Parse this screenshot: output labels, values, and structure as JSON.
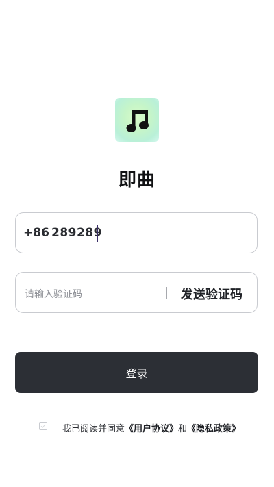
{
  "app": {
    "name": "即曲",
    "logo_icon": "music-note-icon",
    "logo_colors": [
      "#d9fbc9",
      "#b9f0d8"
    ]
  },
  "phone": {
    "country_code": "+86",
    "value": "289289"
  },
  "verification": {
    "placeholder": "请输入验证码",
    "send_label": "发送验证码"
  },
  "login": {
    "label": "登录",
    "bg_color": "#2c2f35"
  },
  "agreement": {
    "checked": false,
    "prefix": "我已阅读并同意",
    "user_agreement": "《用户协议》",
    "conjunction": "和",
    "privacy_policy": "《隐私政策》"
  }
}
